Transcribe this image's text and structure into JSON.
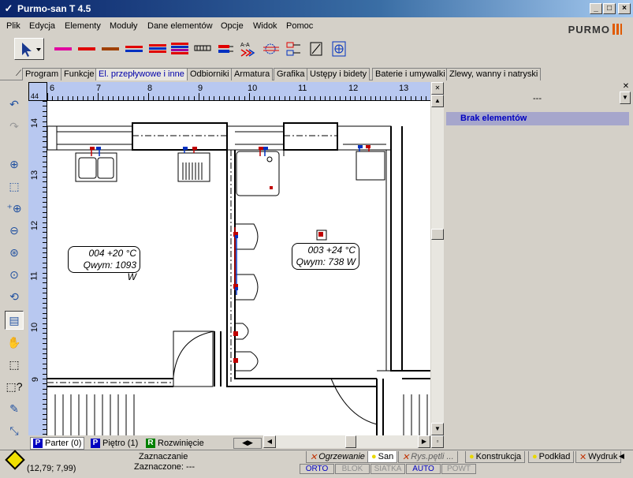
{
  "window": {
    "title": "Purmo-san T 4.5",
    "minimize": "_",
    "maximize": "□",
    "close": "×"
  },
  "menu": [
    "Plik",
    "Edycja",
    "Elementy",
    "Moduły",
    "Dane elementów",
    "Opcje",
    "Widok",
    "Pomoc"
  ],
  "logo": {
    "text": "PURMO"
  },
  "toolbar_icons": [
    "select-arrow-icon",
    "pipe-magenta-icon",
    "pipe-red-icon",
    "pipe-brown-icon",
    "pipe-red-blue-icon",
    "pipe-double-red-blue-icon",
    "radiator-icon",
    "manifold-icon",
    "label-aa-icon",
    "fitting-icon",
    "valve-group-icon",
    "element-diagonal-icon",
    "pump-icon"
  ],
  "tabs": [
    "Program",
    "Funkcje",
    "El. przepływowe i inne",
    "Odbiorniki",
    "Armatura",
    "Grafika",
    "Ustępy i bidety",
    "Baterie i umywalki",
    "Zlewy, wanny i natryski"
  ],
  "active_tab": "El. przepływowe i inne",
  "ruler": {
    "corner": "44",
    "x_labels": [
      "6",
      "7",
      "8",
      "9",
      "10",
      "11",
      "12",
      "13"
    ],
    "y_labels": [
      "14",
      "13",
      "12",
      "11",
      "10",
      "9"
    ]
  },
  "rooms": [
    {
      "line1": "004  +20 °C",
      "line2": "Qwym: 1093 W"
    },
    {
      "line1": "003  +24 °C",
      "line2": "Qwym: 738 W"
    }
  ],
  "right_panel": {
    "combo_value": "---",
    "list_item": "Brak elementów"
  },
  "floor_tabs": [
    {
      "icon": "P",
      "label": "Parter (0)",
      "color": "#0000c0"
    },
    {
      "icon": "P",
      "label": "Piętro (1)",
      "color": "#0000c0"
    },
    {
      "icon": "R",
      "label": "Rozwinięcie",
      "color": "#008000"
    }
  ],
  "status": {
    "coords": "(12,79; 7,99)",
    "selection_title": "Zaznaczanie",
    "selected_label": "Zaznaczone: ---",
    "modes": [
      {
        "label": "ORTO",
        "on": true
      },
      {
        "label": "BLOK",
        "on": false
      },
      {
        "label": "SIATKA",
        "on": false
      },
      {
        "label": "AUTO",
        "on": true
      },
      {
        "label": "POWT",
        "on": false
      }
    ]
  },
  "bottom_tabs": [
    {
      "label": "Ogrzewanie",
      "mark": "✕",
      "color": "#c03000",
      "italic": true
    },
    {
      "label": "San",
      "mark": "●",
      "color": "#e8d800",
      "italic": false,
      "active": true
    },
    {
      "label": "Rys.pętli ...",
      "mark": "✕",
      "color": "#c03000",
      "italic": true
    },
    {
      "label": "Konstrukcja",
      "mark": "●",
      "color": "#e8d800",
      "italic": false
    },
    {
      "label": "Podkład",
      "mark": "●",
      "color": "#e8d800",
      "italic": false
    },
    {
      "label": "Wydruk",
      "mark": "✕",
      "color": "#c03000",
      "italic": false
    }
  ]
}
